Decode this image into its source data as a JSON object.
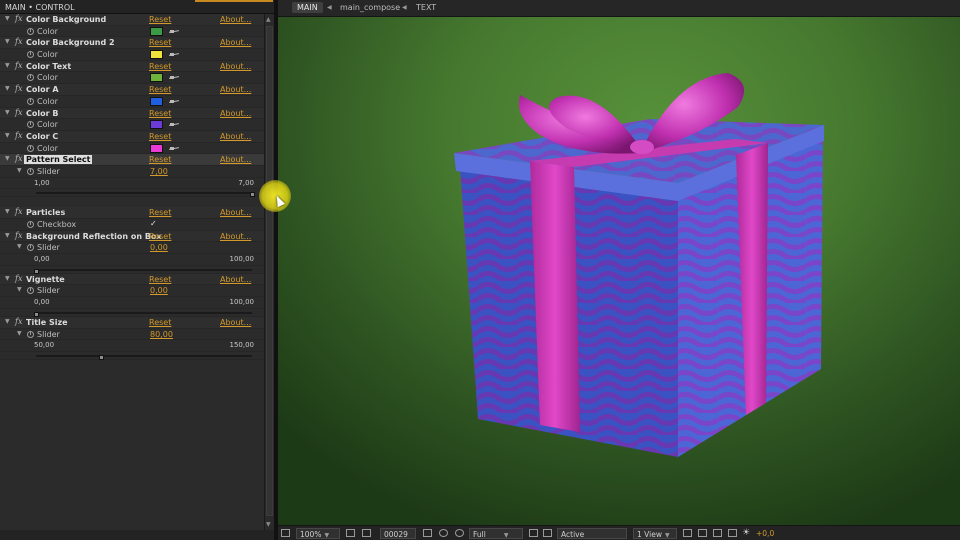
{
  "ec_panel": {
    "title": "MAIN • CONTROL",
    "reset_label": "Reset",
    "about_label": "About...",
    "effects": [
      {
        "name": "Color Background",
        "param": "Color",
        "color": "#3a9a46"
      },
      {
        "name": "Color Background 2",
        "param": "Color",
        "color": "#f0e43a"
      },
      {
        "name": "Color Text",
        "param": "Color",
        "color": "#6db33c"
      },
      {
        "name": "Color A",
        "param": "Color",
        "color": "#1f5fe0"
      },
      {
        "name": "Color B",
        "param": "Color",
        "color": "#6a3bd6"
      },
      {
        "name": "Color C",
        "param": "Color",
        "color": "#e83ad6"
      }
    ],
    "pattern_select": {
      "name": "Pattern Select",
      "param": "Slider",
      "value": "7,00",
      "min": "1,00",
      "max": "7,00",
      "level": 1.0
    },
    "particles": {
      "name": "Particles",
      "param": "Checkbox",
      "checked": "✓"
    },
    "bg_reflection": {
      "name": "Background Reflection on Box",
      "param": "Slider",
      "value": "0,00",
      "min": "0,00",
      "max": "100,00",
      "level": 0.0
    },
    "vignette": {
      "name": "Vignette",
      "param": "Slider",
      "value": "0,00",
      "min": "0,00",
      "max": "100,00",
      "level": 0.0
    },
    "title_size": {
      "name": "Title Size",
      "param": "Slider",
      "value": "80,00",
      "min": "50,00",
      "max": "150,00",
      "level": 0.3
    }
  },
  "viewer": {
    "tabs": [
      "MAIN",
      "main_compose",
      "TEXT"
    ],
    "toolbar": {
      "zoom": "100%",
      "frame": "00029",
      "resolution": "Full",
      "camera": "Active Camera",
      "view": "1 View",
      "exposure": "+0,0"
    }
  },
  "colors": {
    "accent_orange": "#d39a2b",
    "background_green": "#4a7f32",
    "box_blue": "#4a5fd0",
    "ribbon_magenta": "#d13cb4"
  }
}
